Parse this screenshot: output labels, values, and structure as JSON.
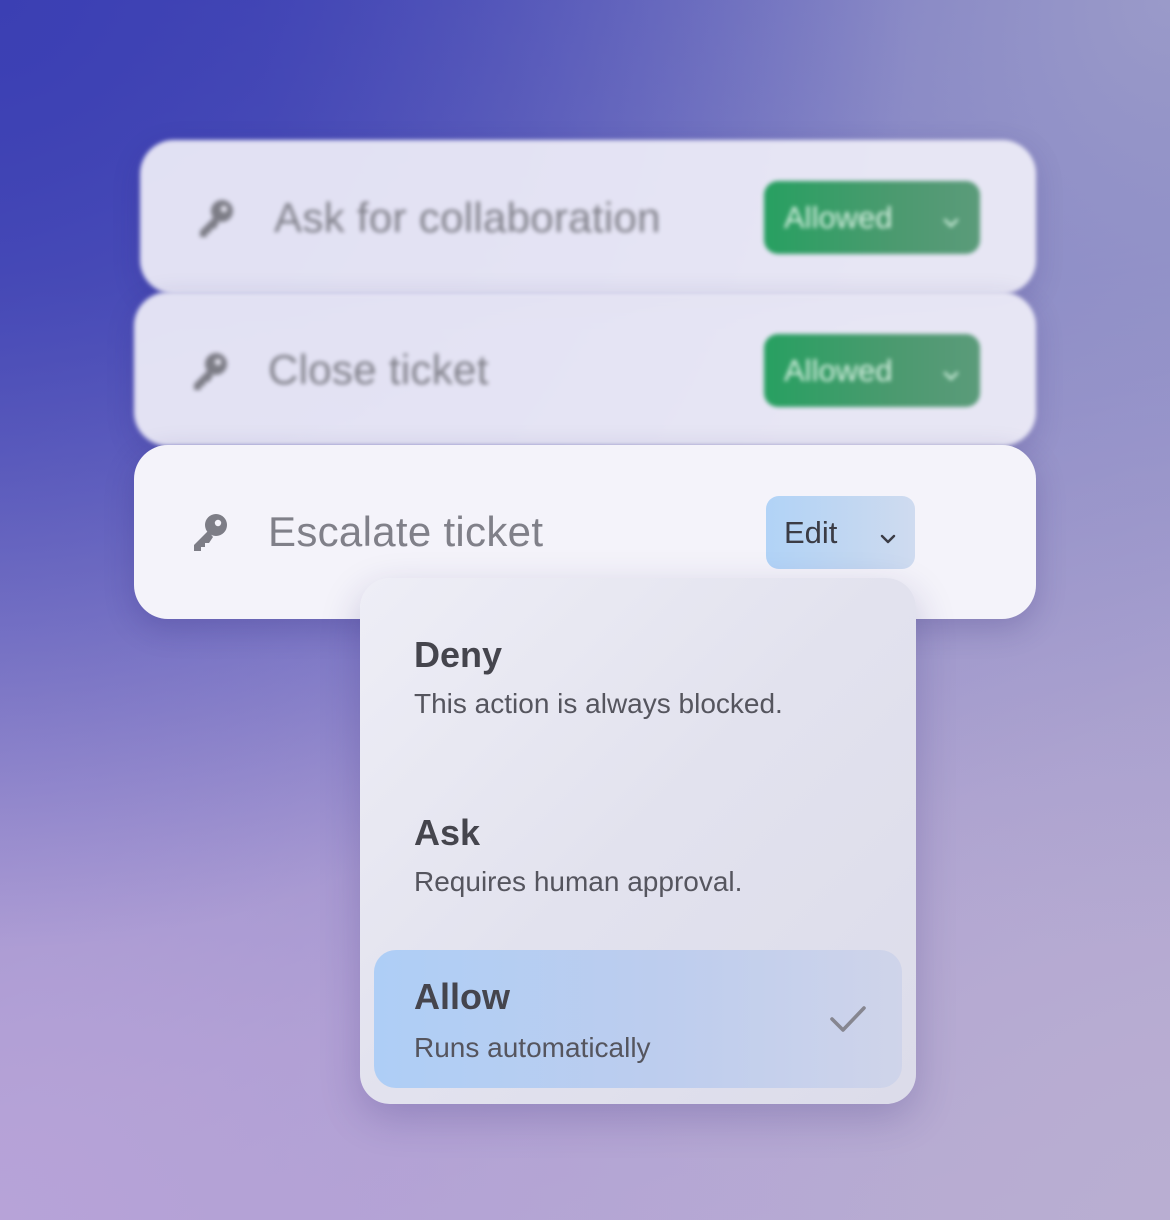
{
  "permissions": [
    {
      "label": "Ask for collaboration",
      "status": "Allowed",
      "icon": "key-icon",
      "focused": false
    },
    {
      "label": "Close ticket",
      "status": "Allowed",
      "icon": "key-icon",
      "focused": false
    },
    {
      "label": "Escalate ticket",
      "control": "Edit",
      "icon": "key-icon",
      "focused": true
    }
  ],
  "dropdown": {
    "options": [
      {
        "title": "Deny",
        "description": "This action is always blocked.",
        "selected": false
      },
      {
        "title": "Ask",
        "description": "Requires human approval.",
        "selected": false
      },
      {
        "title": "Allow",
        "description": "Runs automatically",
        "selected": true
      }
    ]
  },
  "colors": {
    "allowed_badge": "#27a061",
    "edit_button": "#b1d3f7",
    "selected_option": "#aecef6",
    "background_top": "#3b3fb3",
    "background_bottom": "#b7a3d8"
  }
}
